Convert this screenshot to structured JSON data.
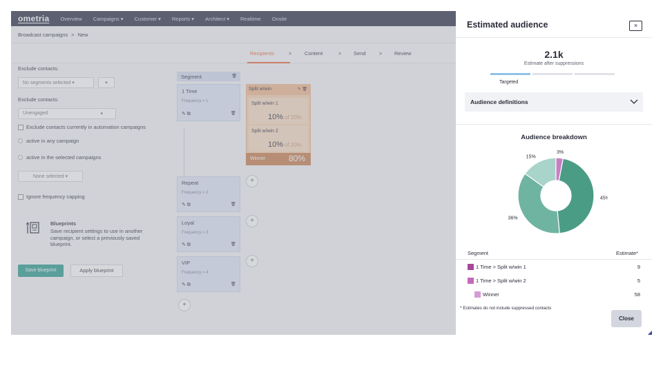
{
  "nav": {
    "logo": "ometria",
    "items": [
      "Overview",
      "Campaigns ▾",
      "Customer ▾",
      "Reports ▾",
      "Architect ▾",
      "Realtime",
      "Onsite"
    ]
  },
  "breadcrumb": {
    "parent": "Broadcast campaigns",
    "separator": ">",
    "current": "New"
  },
  "steps": {
    "items": [
      "Recipients",
      "Content",
      "Send",
      "Review"
    ],
    "active": "Recipients",
    "arrow": ">"
  },
  "left_panel": {
    "exclude_label_1": "Exclude contacts:",
    "segments_select": "No segments selected ▾",
    "filter_button": "▾",
    "exclude_label_2": "Exclude contacts:",
    "unengaged_select": "Unengaged",
    "unengaged_caret": "▾",
    "exclude_automation": "Exclude contacts currently in automation campaigns",
    "active_any": "active in any campaign",
    "active_selected": "active in the selected campaigns",
    "none_selected": "None selected ▾",
    "ignore_frequency": "Ignore frequency capping",
    "blueprints_title": "Blueprints",
    "blueprints_desc": "Save recipient settings to use in another campaign, or select a previously saved blueprint.",
    "save_blueprint": "Save blueprint",
    "apply_blueprint": "Apply blueprint"
  },
  "segments": {
    "header": "Segment",
    "trash_icon": "🗑",
    "edit_icons": "✎ ⧉",
    "cards": [
      {
        "name": "1 Time",
        "freq": "Frequency = 1"
      },
      {
        "name": "Repeat",
        "freq": "Frequency = 2"
      },
      {
        "name": "Loyal",
        "freq": "Frequency = 3"
      },
      {
        "name": "VIP",
        "freq": "Frequency = 4"
      }
    ],
    "plus": "+"
  },
  "split": {
    "header": "Split w/win",
    "header_icons": "✎ 🗑",
    "items": [
      {
        "name": "Split w/win 1",
        "pct": "10%",
        "of": "of 20%"
      },
      {
        "name": "Split w/win 2",
        "pct": "10%",
        "of": "of 20%"
      }
    ],
    "winner_label": "Winner",
    "winner_pct": "80%"
  },
  "panel": {
    "title": "Estimated audience",
    "close_icon": "×",
    "estimate": "2.1k",
    "estimate_label": "Estimate after suppressions",
    "targeted": "Targeted",
    "accordion_label": "Audience definitions",
    "breakdown_title": "Audience breakdown",
    "table_header_segment": "Segment",
    "table_header_estimate": "Estimate*",
    "rows": [
      {
        "label": "1 Time > Split w/win 1",
        "value": "9",
        "color": "#a8479a"
      },
      {
        "label": "1 Time > Split w/win 2",
        "value": "5",
        "color": "#c36aba"
      },
      {
        "label": "Winner",
        "value": "58",
        "color": "#d69bd2"
      }
    ],
    "footnote": "* Estimates do not include suppressed contacts",
    "close_button": "Close"
  },
  "chart_data": {
    "type": "pie",
    "title": "Audience breakdown",
    "categories": [
      "",
      "",
      "",
      ""
    ],
    "values": [
      45,
      36,
      15,
      3
    ],
    "labels": [
      "45%",
      "36%",
      "15%",
      "3%"
    ],
    "colors": [
      "#4b9c85",
      "#6fb4a1",
      "#a9d4c9",
      "#c77ec4"
    ],
    "donut": true
  }
}
